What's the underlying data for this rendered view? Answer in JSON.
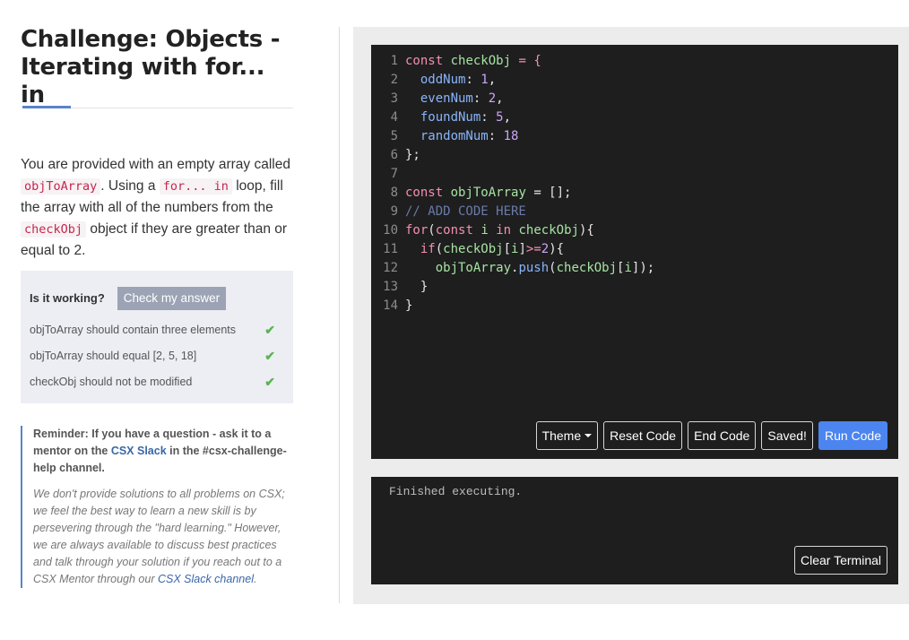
{
  "challenge": {
    "title": "Challenge: Objects - Iterating with for... in",
    "description": {
      "p1": "You are provided with an empty array called ",
      "code1": "objToArray",
      "p2": ". Using a ",
      "code2": "for... in",
      "p3": " loop, fill the array with all of the numbers from the ",
      "code3": "checkObj",
      "p4": " object if they are greater than or equal to 2."
    }
  },
  "tests": {
    "label": "Is it working?",
    "check_button": "Check my answer",
    "items": [
      {
        "text": "objToArray should contain three elements",
        "status_icon": "check-icon"
      },
      {
        "text": "objToArray should equal [2, 5, 18]",
        "status_icon": "check-icon"
      },
      {
        "text": "checkObj should not be modified",
        "status_icon": "check-icon"
      }
    ]
  },
  "reminder": {
    "strong_prefix": "Reminder: If you have a question - ask it to a mentor on the ",
    "strong_link": "CSX Slack",
    "strong_suffix": " in the #csx-challenge-help channel.",
    "italic_prefix": "We don't provide solutions to all problems on CSX; we feel the best way to learn a new skill is by persevering through the \"hard learning.\" However, we are always available to discuss best practices and talk through your solution if you reach out to a CSX Mentor through our ",
    "italic_link": "CSX Slack channel",
    "italic_suffix": "."
  },
  "editor": {
    "lines": [
      "1",
      "2",
      "3",
      "4",
      "5",
      "6",
      "7",
      "8",
      "9",
      "10",
      "11",
      "12",
      "13",
      "14"
    ],
    "code": {
      "l1_kw": "const",
      "l1_var": "checkObj",
      "l1_rest": " = {",
      "l2_prop": "oddNum",
      "l2_num": "1",
      "l3_prop": "evenNum",
      "l3_num": "2",
      "l4_prop": "foundNum",
      "l4_num": "5",
      "l5_prop": "randomNum",
      "l5_num": "18",
      "l6": "};",
      "l8_kw": "const",
      "l8_var": "objToArray",
      "l8_rest": " = [];",
      "l9_cmt": "// ADD CODE HERE",
      "l10_kw": "for",
      "l10_kw2": "const",
      "l10_i": "i",
      "l10_in": "in",
      "l10_var": "checkObj",
      "l11_kw": "if",
      "l11_var": "checkObj",
      "l11_i": "i",
      "l11_num": "2",
      "l12_var": "objToArray",
      "l12_fn": "push",
      "l12_var2": "checkObj",
      "l12_i": "i",
      "l13": "}",
      "l14": "}"
    },
    "buttons": {
      "theme": "Theme",
      "reset": "Reset Code",
      "end": "End Code",
      "saved": "Saved!",
      "run": "Run Code"
    }
  },
  "terminal": {
    "output": "Finished executing.",
    "clear_button": "Clear Terminal"
  },
  "colors": {
    "accent": "#5a84c8",
    "run_button": "#4c85ef",
    "success": "#5ab452",
    "editor_bg": "#1e1e1f"
  }
}
